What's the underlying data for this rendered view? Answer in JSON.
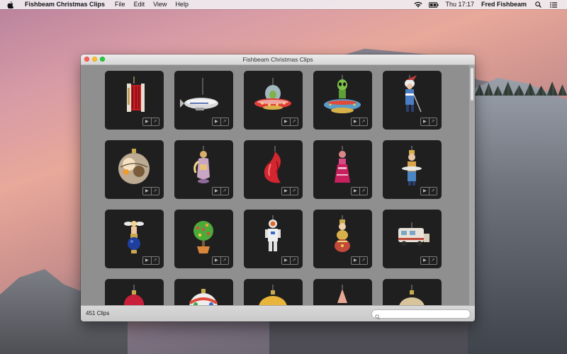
{
  "menubar": {
    "app_name": "Fishbeam Christmas Clips",
    "menus": [
      "File",
      "Edit",
      "View",
      "Help"
    ],
    "clock": "Thu 17:17",
    "user": "Fred Fishbeam",
    "icons": [
      "apple-icon",
      "wifi-icon",
      "battery-icon",
      "spotlight-icon",
      "notification-center-icon"
    ]
  },
  "window": {
    "title": "Fishbeam Christmas Clips",
    "clip_count": "451 Clips",
    "search_placeholder": "",
    "clips": [
      "accordion-ornament",
      "zeppelin-ornament",
      "ufo-ornament",
      "alien-ufo-ornament",
      "santa-golfer-ornament",
      "bauble-ornament",
      "angel-ornament",
      "red-fish-ornament",
      "girl-ornament",
      "chef-ornament",
      "cherub-globe-ornament",
      "tree-pot-ornament",
      "astronaut-ornament",
      "snowman-ornament",
      "caravan-ornament",
      "red-ball-ornament",
      "striped-ball-ornament",
      "gold-ball-ornament",
      "cone-ornament",
      "ball-ornament"
    ],
    "colors": {
      "tile": "#1f1f1f",
      "content": "#8f8f8f"
    }
  }
}
